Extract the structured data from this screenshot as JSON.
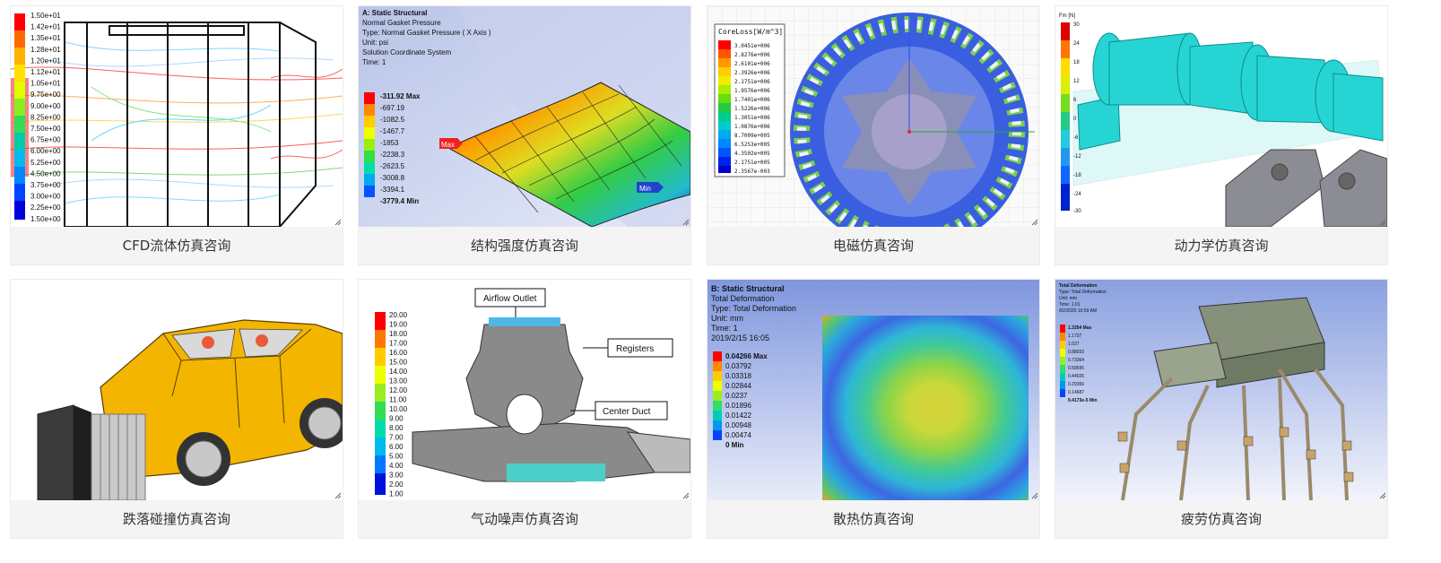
{
  "cards": [
    {
      "caption": "CFD流体仿真咨询",
      "image": {
        "legend": [
          "1.50e+01",
          "1.42e+01",
          "1.35e+01",
          "1.28e+01",
          "1.20e+01",
          "1.12e+01",
          "1.05e+01",
          "9.75e+00",
          "9.00e+00",
          "8.25e+00",
          "7.50e+00",
          "6.75e+00",
          "6.00e+00",
          "5.25e+00",
          "4.50e+00",
          "3.75e+00",
          "3.00e+00",
          "2.25e+00",
          "1.50e+00"
        ]
      }
    },
    {
      "caption": "结构强度仿真咨询",
      "image": {
        "header": [
          "A: Static Structural",
          "Normal Gasket Pressure",
          "Type: Normal Gasket Pressure ( X Axis )",
          "Unit: psi",
          "Solution Coordinate System",
          "Time: 1"
        ],
        "legend": [
          "-311.92 Max",
          "-697.19",
          "-1082.5",
          "-1467.7",
          "-1853",
          "-2238.3",
          "-2623.5",
          "-3008.8",
          "-3394.1",
          "-3779.4 Min"
        ],
        "max_tag": "Max",
        "min_tag": "Min"
      }
    },
    {
      "caption": "电磁仿真咨询",
      "image": {
        "legend_title": "CoreLoss[W/m^3]",
        "legend": [
          "3.0451e+006",
          "2.8276e+006",
          "2.6101e+006",
          "2.3926e+006",
          "2.1751e+006",
          "1.9576e+006",
          "1.7401e+006",
          "1.5226e+006",
          "1.3051e+006",
          "1.0876e+006",
          "8.7009e+005",
          "6.5253e+005",
          "4.3502e+005",
          "2.1751e+005",
          "2.3567e-003"
        ]
      }
    },
    {
      "caption": "动力学仿真咨询",
      "image": {
        "legend_title": "Fm [N]",
        "legend": [
          "30",
          "24",
          "18",
          "12",
          "6",
          "0",
          "-6",
          "-12",
          "-18",
          "-24",
          "-30"
        ]
      }
    },
    {
      "caption": "跌落碰撞仿真咨询",
      "image": {}
    },
    {
      "caption": "气动噪声仿真咨询",
      "image": {
        "legend": [
          "20.00",
          "19.00",
          "18.00",
          "17.00",
          "16.00",
          "15.00",
          "14.00",
          "13.00",
          "12.00",
          "11.00",
          "10.00",
          "9.00",
          "8.00",
          "7.00",
          "6.00",
          "5.00",
          "4.00",
          "3.00",
          "2.00",
          "1.00"
        ],
        "labels": [
          "Airflow Outlet",
          "Registers",
          "Center Duct"
        ]
      }
    },
    {
      "caption": "散热仿真咨询",
      "image": {
        "header": [
          "B: Static Structural",
          "Total Deformation",
          "Type: Total Deformation",
          "Unit: mm",
          "Time: 1",
          "2019/2/15 16:05"
        ],
        "legend": [
          "0.04266 Max",
          "0.03792",
          "0.03318",
          "0.02844",
          "0.0237",
          "0.01896",
          "0.01422",
          "0.00948",
          "0.00474",
          "0 Min"
        ]
      }
    },
    {
      "caption": "疲劳仿真咨询",
      "image": {
        "header": [
          "Total Deformation",
          "Type: Total Deformation",
          "Unit: mm",
          "Time: 1.01",
          "9/2/2020 10:59 AM"
        ],
        "legend": [
          "1.3354 Max",
          "1.1737",
          "1.027",
          "0.88033",
          "0.73364",
          "0.58695",
          "0.44026",
          "0.29356",
          "0.14687",
          "9.4173e-5 Min"
        ]
      }
    }
  ],
  "colors": {
    "card_bg": "#f4f4f4",
    "caption_text": "#333333",
    "legend_scale": [
      "#ff0000",
      "#ff5a00",
      "#ffa500",
      "#ffd500",
      "#ffff00",
      "#aaff00",
      "#33ee33",
      "#00e0a0",
      "#00d0ff",
      "#0088ff",
      "#0033ff"
    ]
  }
}
